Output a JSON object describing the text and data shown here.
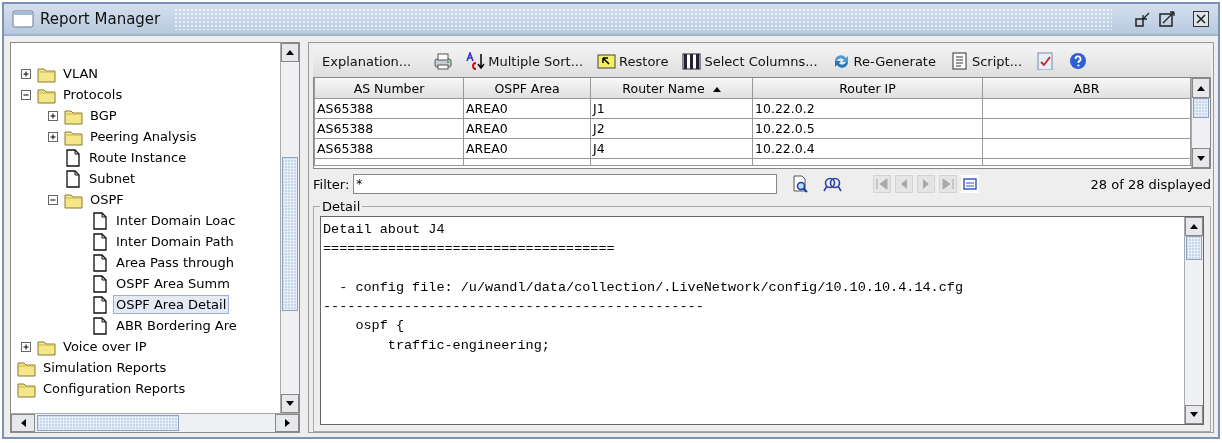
{
  "window": {
    "title": "Report Manager"
  },
  "tree": [
    {
      "label": "VLAN",
      "kind": "folder",
      "expanded": false,
      "selected": false
    },
    {
      "label": "Protocols",
      "kind": "folder",
      "expanded": true,
      "selected": false,
      "children": [
        {
          "label": "BGP",
          "kind": "folder",
          "expanded": false,
          "selected": false
        },
        {
          "label": "Peering Analysis",
          "kind": "folder",
          "expanded": false,
          "selected": false
        },
        {
          "label": "Route Instance",
          "kind": "report",
          "selected": false
        },
        {
          "label": "Subnet",
          "kind": "report",
          "selected": false
        },
        {
          "label": "OSPF",
          "kind": "folder",
          "expanded": true,
          "selected": false,
          "children": [
            {
              "label": "Inter Domain Loac",
              "kind": "report",
              "selected": false
            },
            {
              "label": "Inter Domain Path",
              "kind": "report",
              "selected": false
            },
            {
              "label": "Area Pass through",
              "kind": "report",
              "selected": false
            },
            {
              "label": "OSPF Area Summ",
              "kind": "report",
              "selected": false
            },
            {
              "label": "OSPF Area Detail",
              "kind": "report",
              "selected": true
            },
            {
              "label": "ABR Bordering Are",
              "kind": "report",
              "selected": false
            }
          ]
        }
      ]
    },
    {
      "label": "Voice over IP",
      "kind": "folder",
      "expanded": false,
      "selected": false
    },
    {
      "label": "Simulation Reports",
      "kind": "root-folder",
      "selected": false
    },
    {
      "label": "Configuration Reports",
      "kind": "root-folder",
      "selected": false
    }
  ],
  "toolbar": [
    {
      "kind": "text",
      "label": "Explanation..."
    },
    {
      "kind": "print"
    },
    {
      "kind": "sort",
      "label": "Multiple Sort..."
    },
    {
      "kind": "restore",
      "label": "Restore"
    },
    {
      "kind": "columns",
      "label": "Select Columns..."
    },
    {
      "kind": "regenerate",
      "label": "Re-Generate"
    },
    {
      "kind": "script",
      "label": "Script..."
    },
    {
      "kind": "check"
    },
    {
      "kind": "help"
    }
  ],
  "table": {
    "columns": [
      {
        "label": "AS Number",
        "sorted": false
      },
      {
        "label": "OSPF Area",
        "sorted": false
      },
      {
        "label": "Router Name",
        "sorted": true
      },
      {
        "label": "Router IP",
        "sorted": false
      },
      {
        "label": "ABR",
        "sorted": false
      }
    ],
    "rows": [
      [
        "AS65388",
        "AREA0",
        "J1",
        "10.22.0.2",
        ""
      ],
      [
        "AS65388",
        "AREA0",
        "J2",
        "10.22.0.5",
        ""
      ],
      [
        "AS65388",
        "AREA0",
        "J4",
        "10.22.0.4",
        ""
      ]
    ]
  },
  "filter": {
    "label": "Filter:",
    "value": "*"
  },
  "nav_buttons": [
    {
      "kind": "first",
      "disabled": true
    },
    {
      "kind": "prev",
      "disabled": true
    },
    {
      "kind": "next",
      "disabled": true
    },
    {
      "kind": "last",
      "disabled": true
    },
    {
      "kind": "list",
      "disabled": false
    }
  ],
  "count": "28 of 28 displayed",
  "detail": {
    "title": "Detail",
    "lines": [
      {
        "text": "Detail about J4",
        "gap_before": false
      },
      {
        "text": "====================================",
        "gap_before": false
      },
      {
        "text": "  - config file: /u/wandl/data/collection/.LiveNetwork/config/10.10.10.4.14.cfg",
        "gap_before": true
      },
      {
        "text": "-----------------------------------------------",
        "gap_before": false
      },
      {
        "text": "    ospf {",
        "gap_before": false
      },
      {
        "text": "        traffic-engineering;",
        "gap_before": false
      }
    ]
  }
}
